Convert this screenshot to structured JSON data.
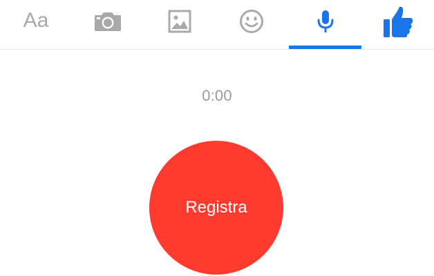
{
  "toolbar": {
    "text_tab_label": "Aa",
    "active_tab": "microphone",
    "tabs": [
      {
        "id": "text",
        "icon": "text-aa-icon"
      },
      {
        "id": "camera",
        "icon": "camera-icon"
      },
      {
        "id": "gallery",
        "icon": "image-icon"
      },
      {
        "id": "emoji",
        "icon": "smiley-icon"
      },
      {
        "id": "microphone",
        "icon": "microphone-icon"
      },
      {
        "id": "like",
        "icon": "thumbs-up-icon"
      }
    ]
  },
  "recorder": {
    "timer": "0:00",
    "button_label": "Registra"
  },
  "colors": {
    "accent": "#1a76e8",
    "icon_inactive": "#a9a9a9",
    "record_button": "#ff3b30",
    "timer_text": "#9a9a9a"
  }
}
